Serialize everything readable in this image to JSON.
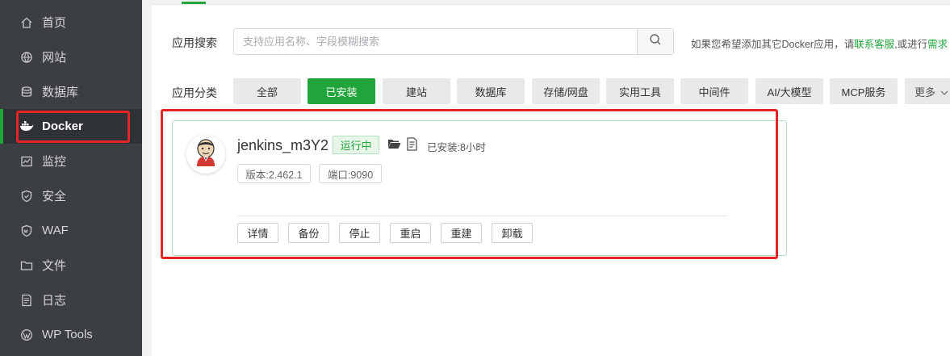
{
  "sidebar": {
    "items": [
      {
        "label": "首页",
        "icon": "home-icon"
      },
      {
        "label": "网站",
        "icon": "globe-icon"
      },
      {
        "label": "数据库",
        "icon": "database-icon"
      },
      {
        "label": "Docker",
        "icon": "docker-icon",
        "active": true
      },
      {
        "label": "监控",
        "icon": "monitor-icon"
      },
      {
        "label": "安全",
        "icon": "shield-icon"
      },
      {
        "label": "WAF",
        "icon": "waf-shield-icon"
      },
      {
        "label": "文件",
        "icon": "folder-icon"
      },
      {
        "label": "日志",
        "icon": "log-icon"
      },
      {
        "label": "WP Tools",
        "icon": "wordpress-icon"
      }
    ]
  },
  "search": {
    "label": "应用搜索",
    "placeholder": "支持应用名称、字段模糊搜索",
    "value": "",
    "hint_prefix": "如果您希望添加其它Docker应用，请",
    "hint_link1": "联系客服",
    "hint_mid": ",或进行",
    "hint_link2": "需求"
  },
  "category": {
    "label": "应用分类",
    "items": [
      "全部",
      "已安装",
      "建站",
      "数据库",
      "存储/网盘",
      "实用工具",
      "中间件",
      "AI/大模型",
      "MCP服务",
      "更多"
    ],
    "active_index": 1
  },
  "app": {
    "name": "jenkins_m3Y2",
    "status": "运行中",
    "installed": "已安装:8小时",
    "version": "版本:2.462.1",
    "port": "端口:9090",
    "actions": [
      "详情",
      "备份",
      "停止",
      "重启",
      "重建",
      "卸载"
    ]
  },
  "colors": {
    "accent": "#20a53a",
    "sidebar_bg": "#3b3f44",
    "highlight": "#e52525"
  }
}
